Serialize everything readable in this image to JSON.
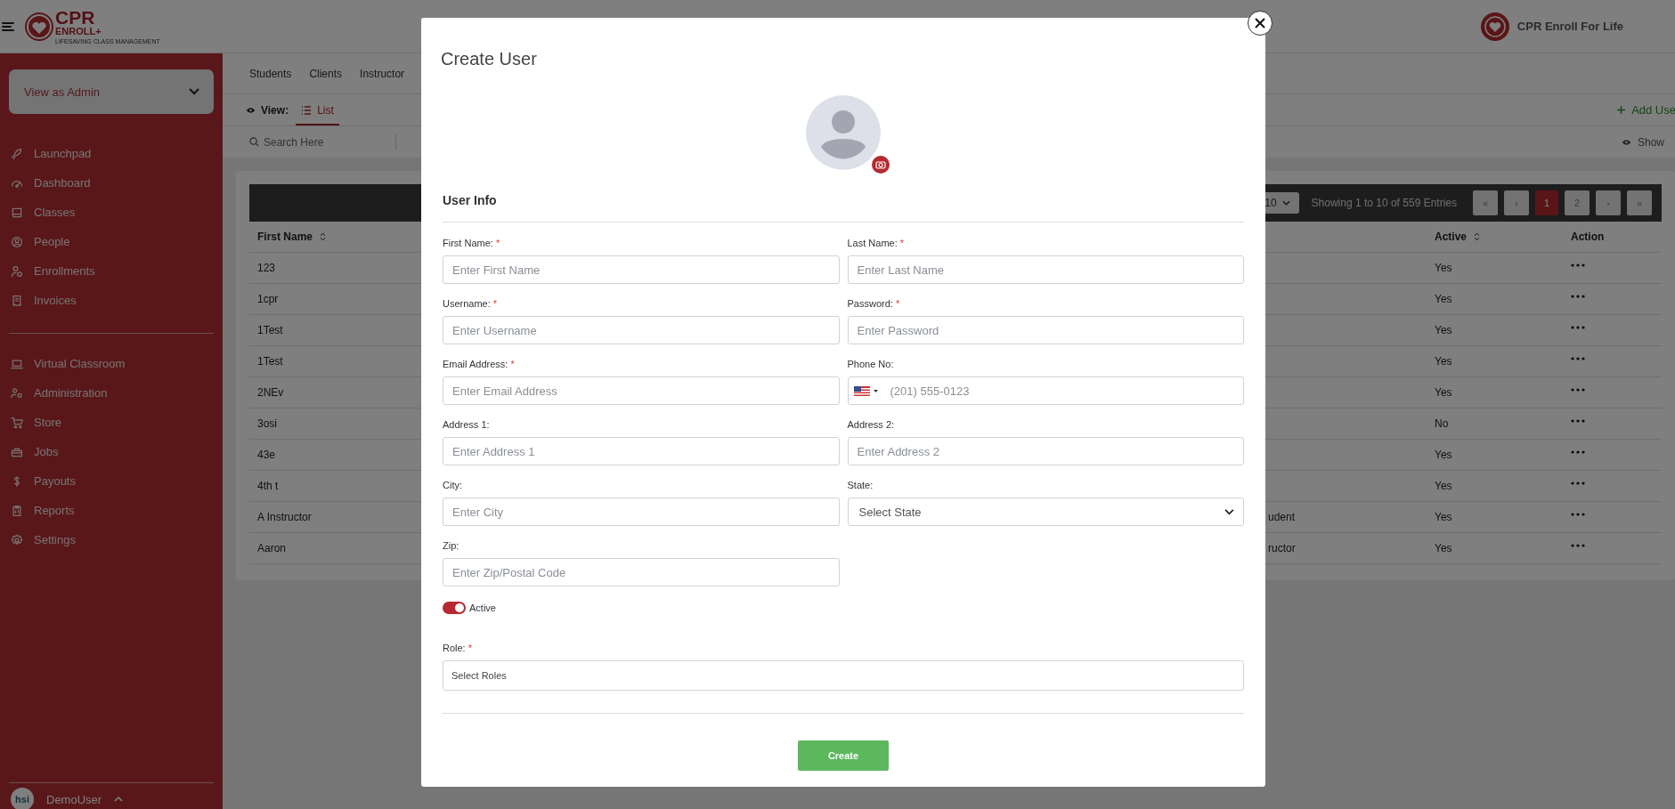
{
  "header": {
    "logo": {
      "title": "CPR",
      "subtitle": "ENROLL+",
      "tagline": "LIFESAVING CLASS MANAGEMENT"
    },
    "org_name": "CPR Enroll For Life"
  },
  "sidebar": {
    "view_select": "View as Admin",
    "groups": [
      [
        {
          "label": "Launchpad"
        },
        {
          "label": "Dashboard"
        },
        {
          "label": "Classes"
        },
        {
          "label": "People"
        },
        {
          "label": "Enrollments"
        },
        {
          "label": "Invoices"
        }
      ],
      [
        {
          "label": "Virtual Classroom"
        },
        {
          "label": "Administration"
        },
        {
          "label": "Store"
        },
        {
          "label": "Jobs"
        },
        {
          "label": "Payouts"
        },
        {
          "label": "Reports"
        },
        {
          "label": "Settings"
        }
      ]
    ],
    "user": {
      "avatar_text": "hsi",
      "name": "DemoUser"
    }
  },
  "tabs": [
    {
      "label": "Students",
      "selected": false
    },
    {
      "label": "Clients",
      "selected": false
    },
    {
      "label": "Instructor",
      "selected": false
    }
  ],
  "view": {
    "label": "View:",
    "options": [
      {
        "label": "List",
        "selected": true
      }
    ]
  },
  "add_button": "Add Use",
  "search": {
    "placeholder": "Search Here"
  },
  "show_button": "Show",
  "table": {
    "page_size": "10",
    "summary": "Showing 1 to 10 of 559 Entries",
    "pages": [
      {
        "label": "«",
        "selected": false
      },
      {
        "label": "‹",
        "selected": false
      },
      {
        "label": "1",
        "selected": true
      },
      {
        "label": "2",
        "selected": false
      },
      {
        "label": "›",
        "selected": false
      },
      {
        "label": "»",
        "selected": false
      }
    ],
    "columns": [
      {
        "label": "First Name",
        "sortable": true
      },
      {
        "label": "Active",
        "sortable": true
      },
      {
        "label": "Action",
        "sortable": false
      }
    ],
    "rows": [
      {
        "first_name": "123",
        "active": "Yes"
      },
      {
        "first_name": "1cpr",
        "active": "Yes"
      },
      {
        "first_name": "1Test",
        "active": "Yes"
      },
      {
        "first_name": "1Test",
        "active": "Yes"
      },
      {
        "first_name": "2NEv",
        "active": "Yes"
      },
      {
        "first_name": "3osi",
        "active": "No"
      },
      {
        "first_name": "43e",
        "active": "Yes"
      },
      {
        "first_name": "4th t",
        "active": "Yes"
      },
      {
        "first_name": "A Instructor",
        "column_2": "udent",
        "active": "Yes"
      },
      {
        "first_name": "Aaron",
        "column_2": "ructor",
        "active": "Yes"
      }
    ]
  },
  "modal": {
    "title": "Create User",
    "section": "User Info",
    "fields": [
      {
        "kind": "text",
        "label": "First Name:",
        "required_mark": "*",
        "placeholder": "Enter First Name"
      },
      {
        "kind": "text",
        "label": "Last Name:",
        "required_mark": "*",
        "placeholder": "Enter Last Name"
      },
      {
        "kind": "text",
        "label": "Username:",
        "required_mark": "*",
        "placeholder": "Enter Username"
      },
      {
        "kind": "text",
        "label": "Password:",
        "required_mark": "*",
        "placeholder": "Enter Password"
      },
      {
        "kind": "text",
        "label": "Email Address:",
        "required_mark": "*",
        "placeholder": "Enter Email Address"
      },
      {
        "kind": "phone",
        "label": "Phone No:",
        "placeholder": "(201) 555-0123"
      },
      {
        "kind": "text",
        "label": "Address 1:",
        "placeholder": "Enter Address 1"
      },
      {
        "kind": "text",
        "label": "Address 2:",
        "placeholder": "Enter Address 2"
      },
      {
        "kind": "text",
        "label": "City:",
        "placeholder": "Enter City"
      },
      {
        "kind": "select",
        "label": "State:",
        "placeholder": "Select State"
      },
      {
        "kind": "text",
        "label": "Zip:",
        "placeholder": "Enter Zip/Postal Code"
      }
    ],
    "toggle": {
      "label": "Active",
      "on": true
    },
    "role": {
      "label": "Role:",
      "required_mark": "*",
      "placeholder": "Select Roles"
    },
    "submit": "Create"
  }
}
